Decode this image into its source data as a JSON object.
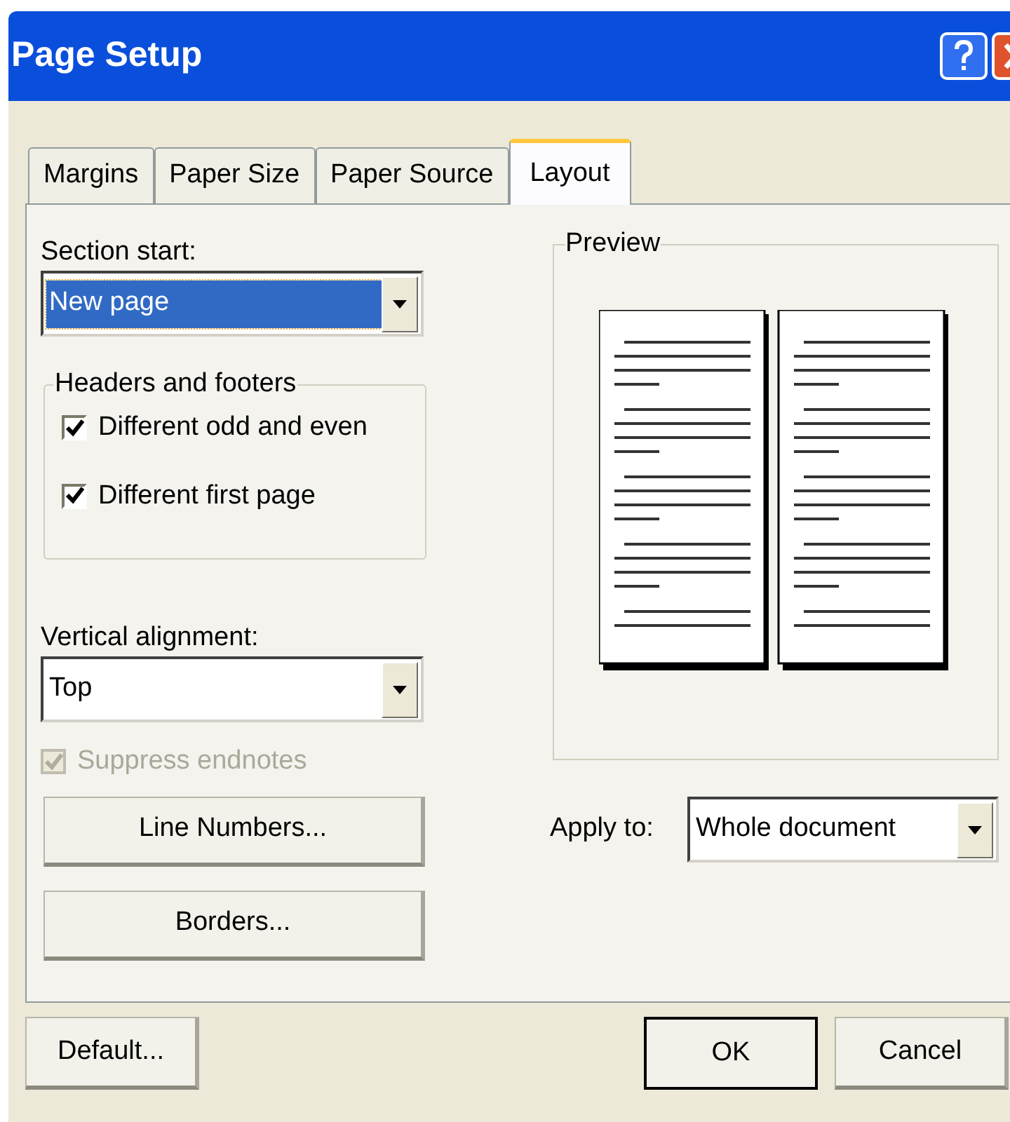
{
  "window": {
    "title": "Page Setup"
  },
  "tabs": [
    {
      "label": "Margins",
      "selected": false
    },
    {
      "label": "Paper Size",
      "selected": false
    },
    {
      "label": "Paper Source",
      "selected": false
    },
    {
      "label": "Layout",
      "selected": true
    }
  ],
  "section_start": {
    "label": "Section start:",
    "value": "New page",
    "highlighted": true
  },
  "headers_and_footers": {
    "title": "Headers and footers",
    "options": [
      {
        "label": "Different odd and even",
        "checked": true
      },
      {
        "label": "Different first page",
        "checked": true
      }
    ]
  },
  "vertical_alignment": {
    "label": "Vertical alignment:",
    "value": "Top",
    "highlighted": false
  },
  "suppress_endnotes": {
    "label": "Suppress endnotes",
    "checked": true,
    "disabled": true
  },
  "section_buttons": [
    "Line Numbers...",
    "Borders..."
  ],
  "preview": {
    "title": "Preview"
  },
  "apply_to": {
    "label": "Apply to:",
    "value": "Whole document",
    "highlighted": false
  },
  "footer_buttons": [
    {
      "label": "Default...",
      "default": false
    },
    {
      "label": "OK",
      "default": true
    },
    {
      "label": "Cancel",
      "default": false
    }
  ]
}
